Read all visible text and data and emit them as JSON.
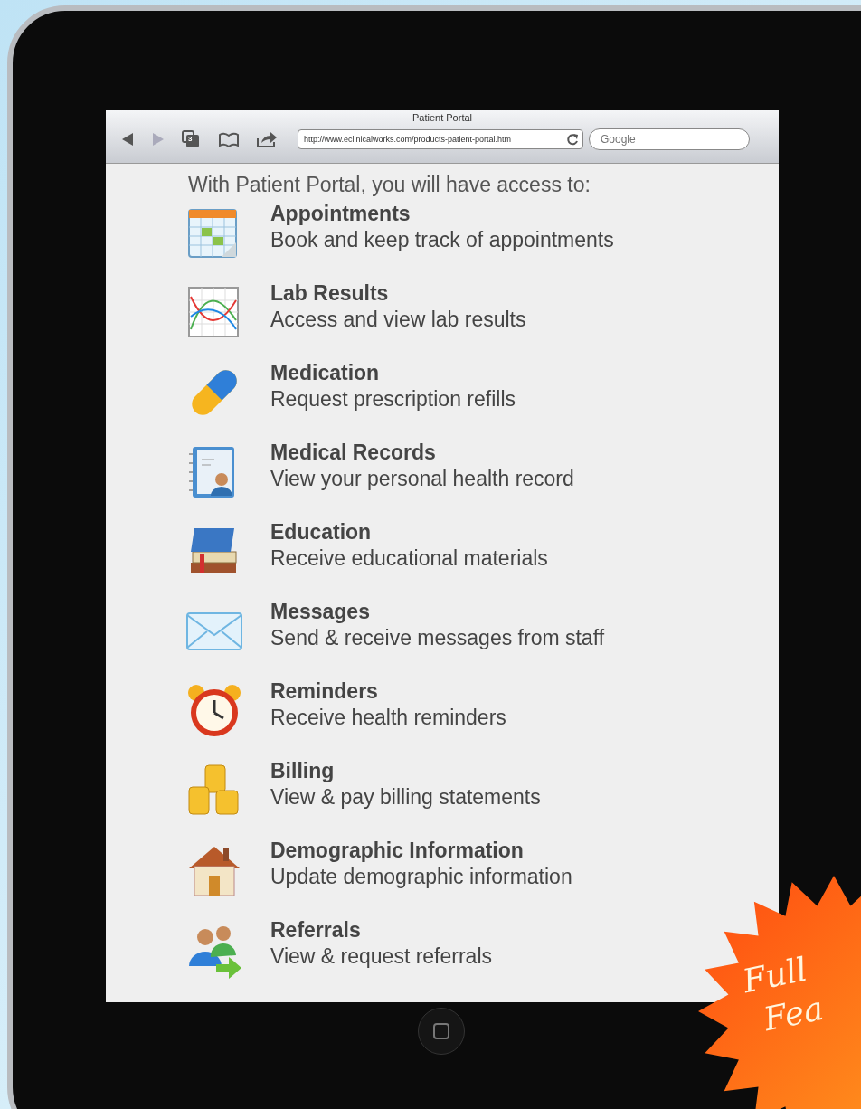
{
  "browser": {
    "title": "Patient Portal",
    "back": {
      "disabled": false
    },
    "forward": {
      "disabled": true
    },
    "tab_count": "3",
    "url": "http://www.eclinicalworks.com/products-patient-portal.htm",
    "search": {
      "placeholder": "Google"
    }
  },
  "page": {
    "heading": "With Patient Portal, you will have access to:",
    "features": [
      {
        "title": "Appointments",
        "description": "Book and keep track of appointments"
      },
      {
        "title": "Lab Results",
        "description": "Access and view lab results"
      },
      {
        "title": "Medication",
        "description": "Request prescription refills"
      },
      {
        "title": "Medical Records",
        "description": "View your personal health record"
      },
      {
        "title": "Education",
        "description": "Receive educational materials"
      },
      {
        "title": "Messages",
        "description": "Send & receive messages from staff"
      },
      {
        "title": "Reminders",
        "description": "Receive health reminders"
      },
      {
        "title": "Billing",
        "description": "View & pay billing statements"
      },
      {
        "title": "Demographic Information",
        "description": "Update demographic information"
      },
      {
        "title": "Referrals",
        "description": "View & request referrals"
      }
    ]
  },
  "badge": {
    "lines": [
      "Full",
      "Fea"
    ]
  }
}
